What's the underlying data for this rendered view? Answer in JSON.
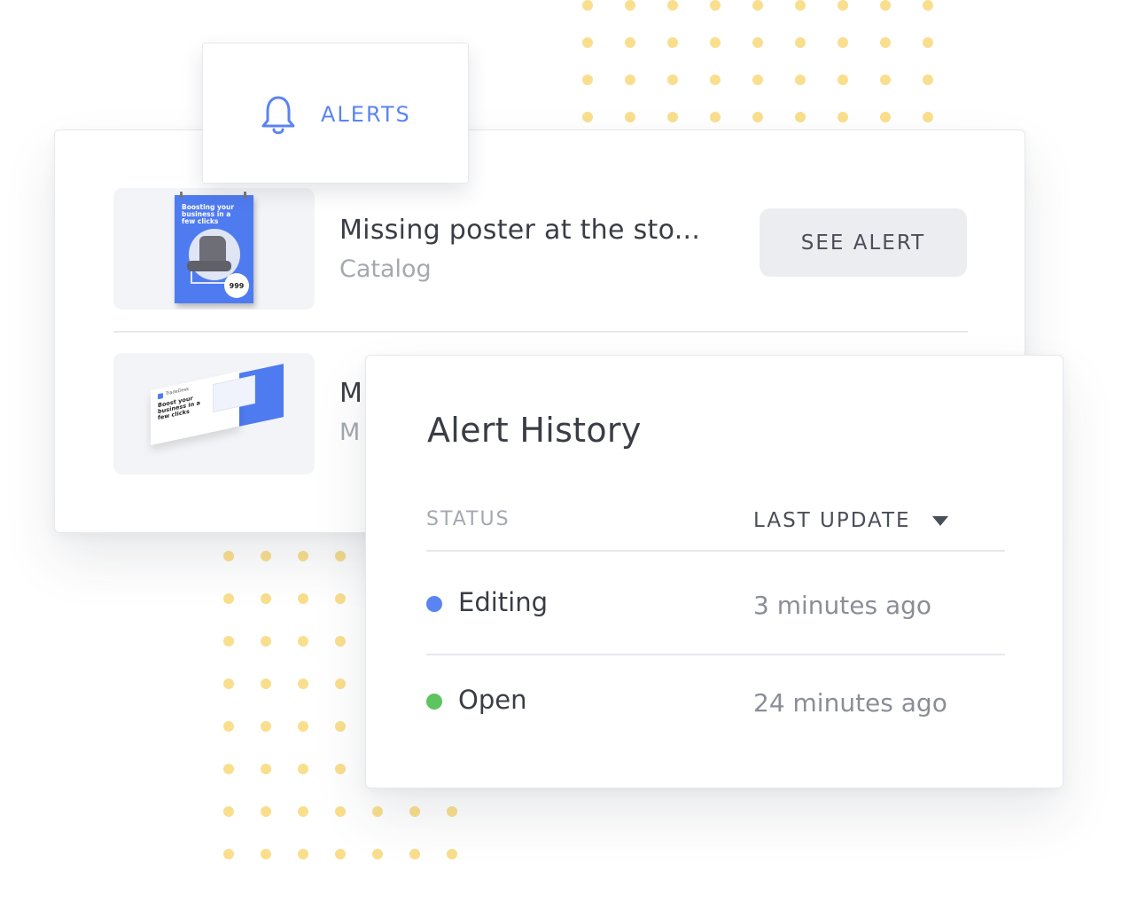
{
  "alerts_tab": {
    "label": "ALERTS",
    "icon": "bell-icon"
  },
  "alerts": [
    {
      "title": "Missing poster at the sto...",
      "category": "Catalog",
      "button_label": "SEE ALERT",
      "thumbnail": {
        "text": "Boosting your business in a few clicks",
        "price": "999"
      }
    },
    {
      "title": "M",
      "category": "M",
      "thumbnail": {
        "brand": "TradeDesk",
        "text": "Boost your business in a few clicks"
      }
    }
  ],
  "history": {
    "title": "Alert History",
    "columns": {
      "status": "STATUS",
      "last_update": "LAST UPDATE"
    },
    "rows": [
      {
        "status": "Editing",
        "updated": "3 minutes ago",
        "color": "#5b84f2"
      },
      {
        "status": "Open",
        "updated": "24 minutes ago",
        "color": "#5ec45f"
      }
    ]
  },
  "colors": {
    "accent": "#5b84f2",
    "dots": "#f9df8d",
    "status_editing": "#5b84f2",
    "status_open": "#5ec45f"
  }
}
